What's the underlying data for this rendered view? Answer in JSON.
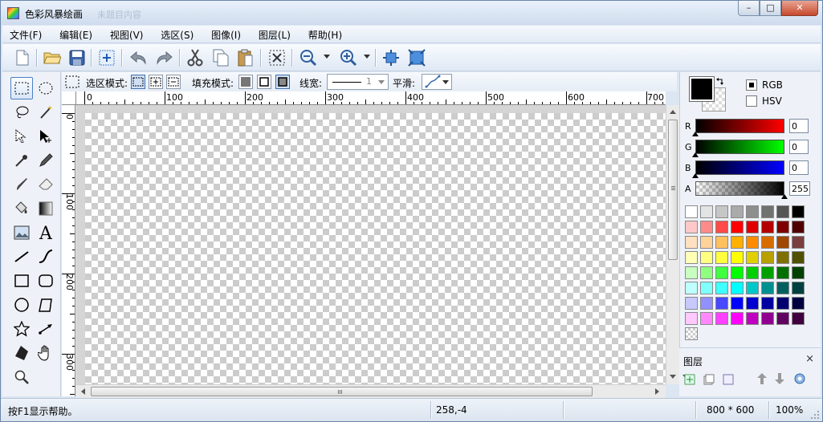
{
  "window": {
    "title": "色彩风暴绘画",
    "ghost_text": "未题目内容",
    "controls": {
      "minimize": "–",
      "maximize": "□",
      "close": "✕"
    }
  },
  "menu": [
    "文件(F)",
    "编辑(E)",
    "视图(V)",
    "选区(S)",
    "图像(I)",
    "图层(L)",
    "帮助(H)"
  ],
  "toolbar": {
    "icons": [
      "new-file-icon",
      "open-folder-icon",
      "save-icon",
      "add-image-icon",
      "undo-icon",
      "redo-icon",
      "cut-icon",
      "copy-icon",
      "paste-icon",
      "deselect-icon",
      "zoom-out-icon",
      "zoom-in-icon",
      "fit-window-icon",
      "actual-size-icon"
    ]
  },
  "options": {
    "select_mode_label": "选区模式:",
    "fill_mode_label": "填充模式:",
    "line_width_label": "线宽:",
    "line_width_value": "1",
    "smooth_label": "平滑:"
  },
  "rulers": {
    "horizontal": [
      "0",
      "100",
      "200",
      "300",
      "400",
      "500",
      "600",
      "700"
    ],
    "vertical": [
      "0",
      "100",
      "200",
      "300"
    ]
  },
  "color_panel": {
    "mode_rgb": "RGB",
    "mode_hsv": "HSV",
    "selected_mode": "RGB",
    "channels": [
      {
        "label": "R",
        "value": "0",
        "color": "#ff0000"
      },
      {
        "label": "G",
        "value": "0",
        "color": "#00ff00"
      },
      {
        "label": "B",
        "value": "0",
        "color": "#0000ff"
      },
      {
        "label": "A",
        "value": "255",
        "color": "#000000"
      }
    ],
    "foreground": "#000000",
    "palette": [
      "#ffffff",
      "#e3e3e3",
      "#c6c6c6",
      "#aaaaaa",
      "#8e8e8e",
      "#717171",
      "#555555",
      "#000000",
      "#ffc8c8",
      "#ff8a8a",
      "#ff4a4a",
      "#ff0000",
      "#e00000",
      "#b40000",
      "#800000",
      "#500000",
      "#ffe0c0",
      "#ffd29a",
      "#ffc060",
      "#ffb000",
      "#ff8c00",
      "#d86c00",
      "#a04800",
      "#7a3e3e",
      "#ffffb8",
      "#ffff80",
      "#ffff40",
      "#ffff00",
      "#e0d000",
      "#b8a000",
      "#807000",
      "#505000",
      "#c8ffc0",
      "#90ff80",
      "#40ff40",
      "#00ff00",
      "#00d000",
      "#00a000",
      "#007000",
      "#004000",
      "#c0ffff",
      "#80ffff",
      "#40ffff",
      "#00ffff",
      "#00c8c8",
      "#009090",
      "#006060",
      "#004040",
      "#c8c8ff",
      "#9090ff",
      "#4848ff",
      "#0000ff",
      "#0000d0",
      "#0000a0",
      "#000070",
      "#000040",
      "#ffc8ff",
      "#ff88ff",
      "#ff40ff",
      "#ff00ff",
      "#c000c0",
      "#900090",
      "#600060",
      "#400040"
    ]
  },
  "layers": {
    "title": "图层",
    "close": "×"
  },
  "status": {
    "help": "按F1显示帮助。",
    "coords": "258,-4",
    "size": "800 * 600",
    "zoom": "100%"
  }
}
